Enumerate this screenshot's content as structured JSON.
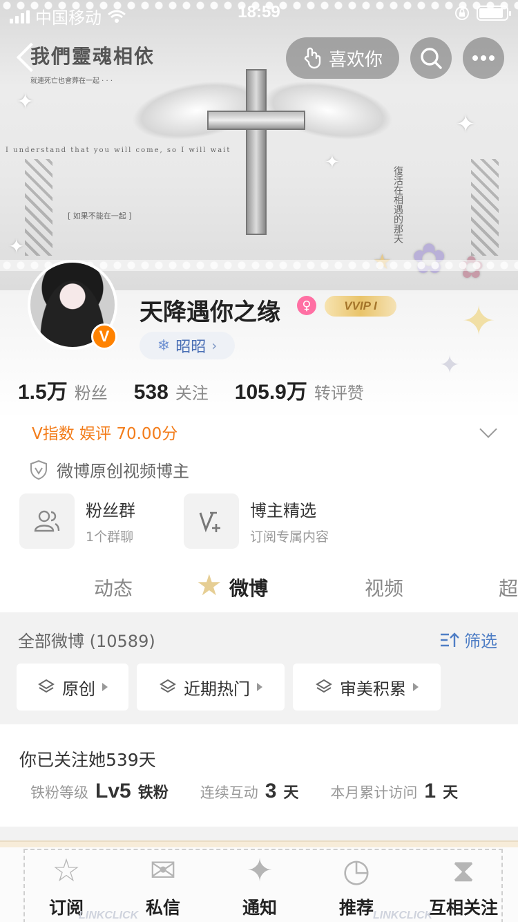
{
  "status_bar": {
    "carrier": "中国移动",
    "time": "18:59",
    "battery_level": 0.9
  },
  "banner": {
    "headline": "我們靈魂相依",
    "subline": "就連死亡也會葬在一起 · · ·",
    "caption_left": "I understand that you will come, so I will wait",
    "caption_vertical": "復活在相遇的那天",
    "caption_box": "[ 如果不能在一起 ]",
    "colors": {
      "base": "#e6e6e6"
    }
  },
  "nav": {
    "like_label": "喜欢你"
  },
  "profile": {
    "name": "天降遇你之缘",
    "gender": "♀",
    "vip_label": "VVIP I",
    "verified_badge": "V",
    "tag": "昭昭",
    "stats": [
      {
        "num": "1.5万",
        "label": "粉丝"
      },
      {
        "num": "538",
        "label": "关注"
      },
      {
        "num": "105.9万",
        "label": "转评赞"
      }
    ],
    "v_index": "V指数 娱评 70.00分",
    "verification": "微博原创视频博主"
  },
  "features": [
    {
      "title": "粉丝群",
      "sub": "1个群聊",
      "icon": "group-icon"
    },
    {
      "title": "博主精选",
      "sub": "订阅专属内容",
      "icon": "v-plus-icon"
    }
  ],
  "tabs": [
    "动态",
    "微博",
    "视频",
    "超"
  ],
  "feed": {
    "all_label": "全部微博 (10589)",
    "filter_label": "筛选",
    "chips": [
      "原创",
      "近期热门",
      "审美积累"
    ]
  },
  "follow": {
    "title": "你已关注她539天",
    "level_label": "铁粉等级",
    "level_value": "Lv5",
    "level_unit": "铁粉",
    "streak_label": "连续互动",
    "streak_value": "3",
    "streak_unit": "天",
    "visits_label": "本月累计访问",
    "visits_value": "1",
    "visits_unit": "天"
  },
  "promo": {
    "items": [
      {
        "label": "订阅",
        "icon": "star-icon"
      },
      {
        "label": "私信",
        "icon": "envelope-icon"
      },
      {
        "label": "通知",
        "icon": "sparkle-icon"
      },
      {
        "label": "推荐",
        "icon": "clock-icon"
      },
      {
        "label": "互相关注",
        "icon": "hourglass-icon"
      }
    ],
    "watermark": "LINKCLICK"
  },
  "accent_colors": {
    "orange": "#ff8200",
    "blue": "#4f7ec5",
    "v_index": "#f37d1b"
  }
}
